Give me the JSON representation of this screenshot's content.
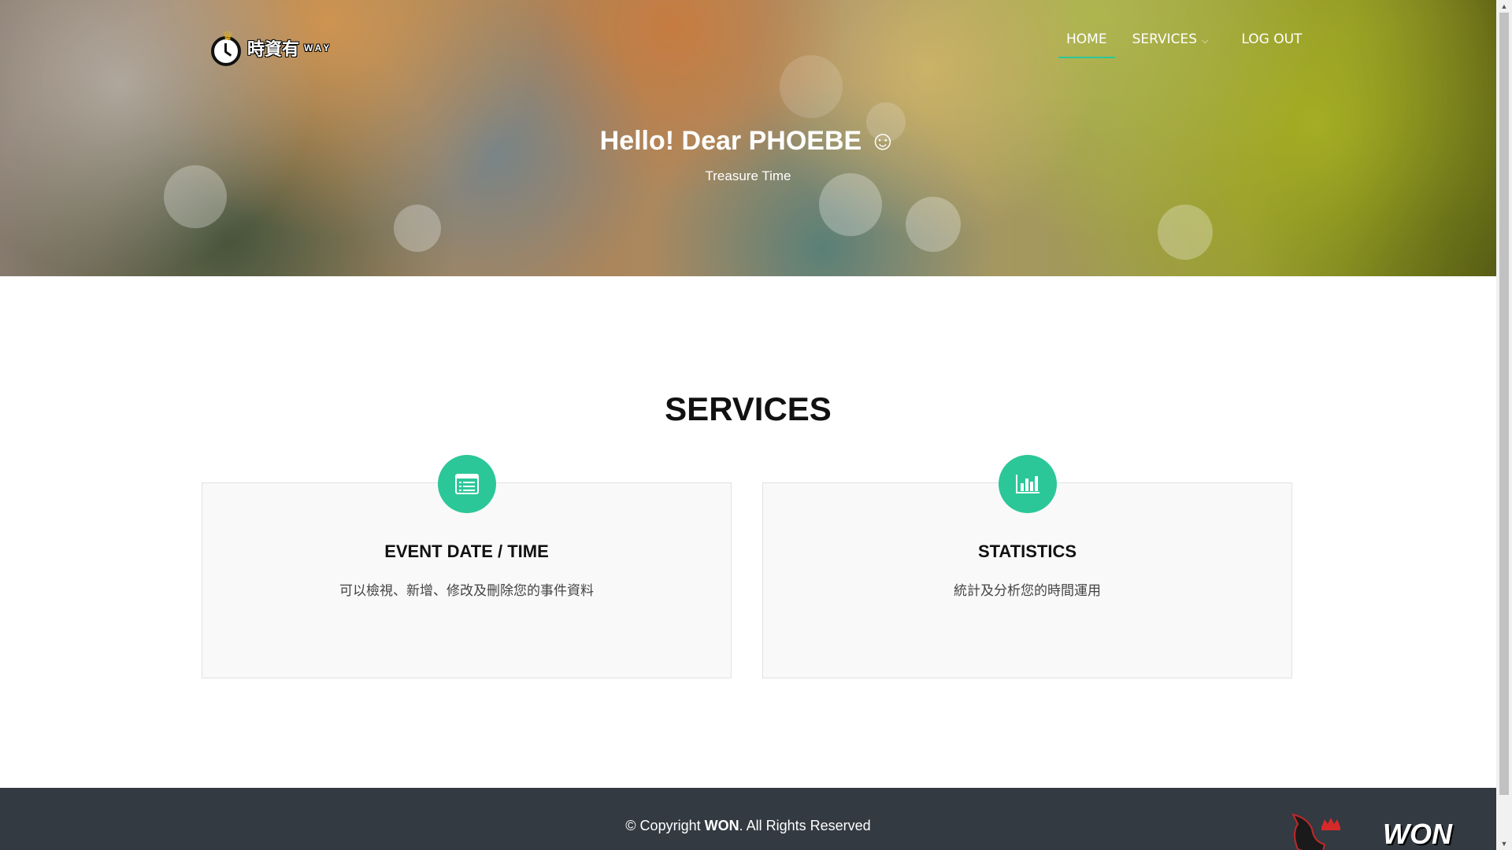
{
  "header": {
    "logo_text": "時資有",
    "logo_way": "WAY",
    "nav": {
      "home": "HOME",
      "services": "SERVICES",
      "logout": "LOG OUT"
    }
  },
  "hero": {
    "title": "Hello! Dear PHOEBE ☺",
    "subtitle": "Treasure Time"
  },
  "services": {
    "heading": "SERVICES",
    "cards": [
      {
        "icon": "list-icon",
        "title": "EVENT DATE / TIME",
        "description": "可以檢視、新增、修改及刪除您的事件資料"
      },
      {
        "icon": "bar-chart-icon",
        "title": "STATISTICS",
        "description": "統計及分析您的時間運用"
      }
    ]
  },
  "footer": {
    "copyright_prefix": "© Copyright ",
    "copyright_brand": "WON",
    "copyright_suffix": ". All Rights Reserved",
    "logo_text": "WON"
  },
  "colors": {
    "accent": "#2cc798",
    "footer_bg": "#333a41"
  }
}
